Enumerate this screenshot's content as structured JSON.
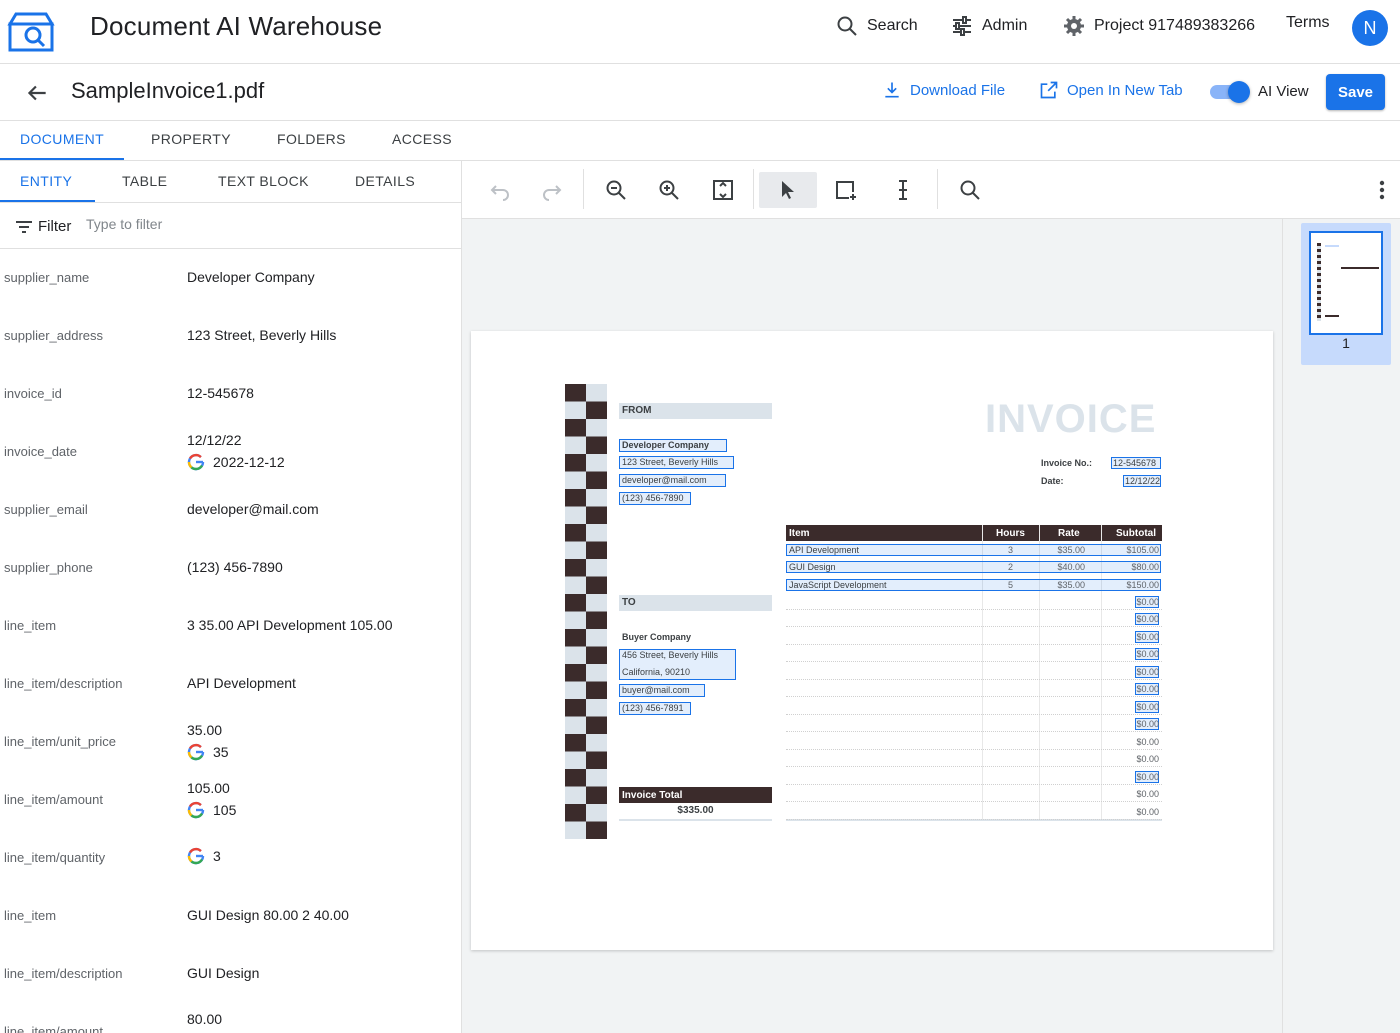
{
  "header": {
    "app_title": "Document AI Warehouse",
    "search_label": "Search",
    "admin_label": "Admin",
    "project_label": "Project 917489383266",
    "terms_label": "Terms",
    "avatar_initial": "N"
  },
  "filebar": {
    "filename": "SampleInvoice1.pdf",
    "download_label": "Download File",
    "open_tab_label": "Open In New Tab",
    "ai_view_label": "AI View",
    "ai_view_on": true,
    "save_label": "Save"
  },
  "main_tabs": [
    {
      "label": "DOCUMENT",
      "active": true
    },
    {
      "label": "PROPERTY",
      "active": false
    },
    {
      "label": "FOLDERS",
      "active": false
    },
    {
      "label": "ACCESS",
      "active": false
    }
  ],
  "sub_tabs": [
    {
      "label": "ENTITY",
      "active": true
    },
    {
      "label": "TABLE",
      "active": false
    },
    {
      "label": "TEXT BLOCK",
      "active": false
    },
    {
      "label": "DETAILS",
      "active": false
    }
  ],
  "filter": {
    "label": "Filter",
    "placeholder": "Type to filter"
  },
  "entities": [
    {
      "key": "supplier_name",
      "value": "Developer Company",
      "normalized": ""
    },
    {
      "key": "supplier_address",
      "value": "123 Street, Beverly Hills",
      "normalized": ""
    },
    {
      "key": "invoice_id",
      "value": "12-545678",
      "normalized": ""
    },
    {
      "key": "invoice_date",
      "value": "12/12/22",
      "normalized": "2022-12-12"
    },
    {
      "key": "supplier_email",
      "value": "developer@mail.com",
      "normalized": ""
    },
    {
      "key": "supplier_phone",
      "value": "(123) 456-7890",
      "normalized": ""
    },
    {
      "key": "line_item",
      "value": "3 35.00 API Development 105.00",
      "normalized": ""
    },
    {
      "key": "line_item/description",
      "value": "API Development",
      "normalized": ""
    },
    {
      "key": "line_item/unit_price",
      "value": "35.00",
      "normalized": "35"
    },
    {
      "key": "line_item/amount",
      "value": "105.00",
      "normalized": "105"
    },
    {
      "key": "line_item/quantity",
      "value": "",
      "normalized": "3"
    },
    {
      "key": "line_item",
      "value": "GUI Design 80.00 2 40.00",
      "normalized": ""
    },
    {
      "key": "line_item/description",
      "value": "GUI Design",
      "normalized": ""
    },
    {
      "key": "line_item/amount",
      "value": "80.00",
      "normalized": ""
    }
  ],
  "invoice": {
    "title": "INVOICE",
    "from_label": "FROM",
    "from_name": "Developer Company",
    "from_address": "123 Street, Beverly Hills",
    "from_email": "developer@mail.com",
    "from_phone": "(123) 456-7890",
    "to_label": "TO",
    "to_name": "Buyer Company",
    "to_address": "456 Street, Beverly Hills",
    "to_city": "California, 90210",
    "to_email": "buyer@mail.com",
    "to_phone": "(123) 456-7891",
    "invoice_no_label": "Invoice No.:",
    "invoice_no": "12-545678",
    "date_label": "Date:",
    "date": "12/12/22",
    "table_headers": [
      "Item",
      "Hours",
      "Rate",
      "Subtotal"
    ],
    "items": [
      {
        "item": "API Development",
        "hours": "3",
        "rate": "$35.00",
        "subtotal": "$105.00"
      },
      {
        "item": "GUI Design",
        "hours": "2",
        "rate": "$40.00",
        "subtotal": "$80.00"
      },
      {
        "item": "JavaScript Development",
        "hours": "5",
        "rate": "$35.00",
        "subtotal": "$150.00"
      }
    ],
    "empty_subtotal": "$0.00",
    "total_label": "Invoice Total",
    "total_value": "$335.00"
  },
  "thumbnail": {
    "page_number": "1"
  }
}
